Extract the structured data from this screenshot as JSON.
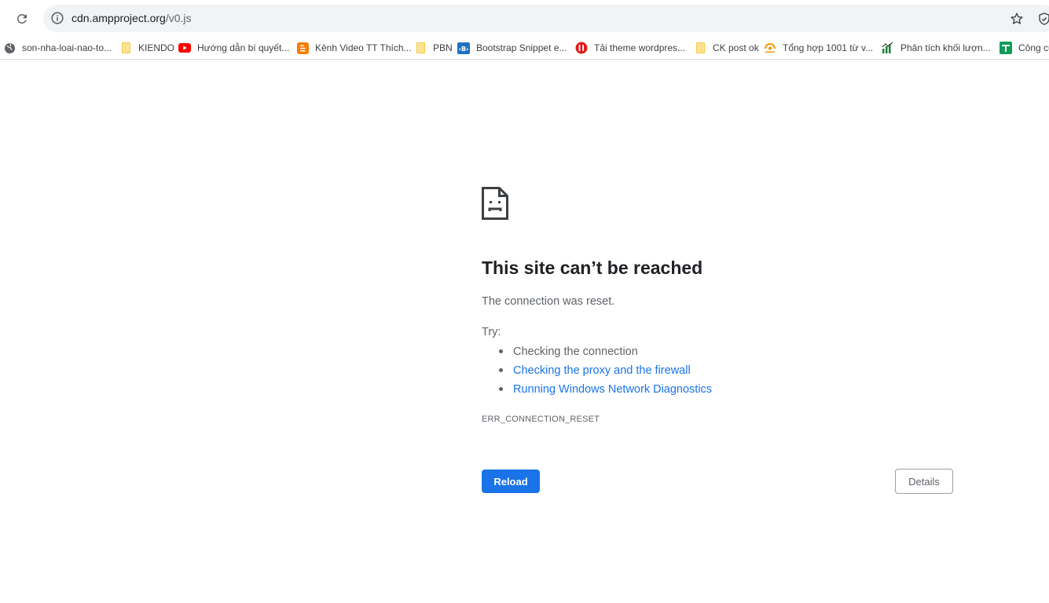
{
  "toolbar": {
    "url_host": "cdn.ampproject.org",
    "url_path": "/v0.js",
    "reload_icon": "reload-icon",
    "info_icon": "info-icon",
    "star_icon": "star-icon",
    "shield_icon": "shield-icon"
  },
  "bookmarks": [
    {
      "label": "son-nha-loai-nao-to...",
      "icon": "globe-icon"
    },
    {
      "label": "KIENDO",
      "icon": "folder-icon"
    },
    {
      "label": "Hướng dẫn bí quyết...",
      "icon": "youtube-icon"
    },
    {
      "label": "Kênh Video TT Thích...",
      "icon": "blogger-icon"
    },
    {
      "label": "PBN",
      "icon": "folder-icon"
    },
    {
      "label": "Bootstrap Snippet e...",
      "icon": "bootstrap-icon"
    },
    {
      "label": "Tải theme wordpres...",
      "icon": "red-circle-icon"
    },
    {
      "label": "CK post ok",
      "icon": "folder-icon"
    },
    {
      "label": "Tổng hợp 1001 từ v...",
      "icon": "orange-logo-icon"
    },
    {
      "label": "Phân tích khối lượn...",
      "icon": "chart-logo-icon"
    },
    {
      "label": "Công cụ",
      "icon": "green-sheet-icon"
    }
  ],
  "error": {
    "icon": "sad-page-icon",
    "title": "This site can’t be reached",
    "message": "The connection was reset.",
    "try_label": "Try:",
    "suggestions": [
      {
        "text": "Checking the connection",
        "link": false
      },
      {
        "text": "Checking the proxy and the firewall",
        "link": true
      },
      {
        "text": "Running Windows Network Diagnostics",
        "link": true
      }
    ],
    "code": "ERR_CONNECTION_RESET",
    "reload_label": "Reload",
    "details_label": "Details"
  },
  "colors": {
    "accent": "#1a73e8",
    "text": "#202124",
    "secondary_text": "#5f6368",
    "omnibox_bg": "#f1f3f4"
  }
}
